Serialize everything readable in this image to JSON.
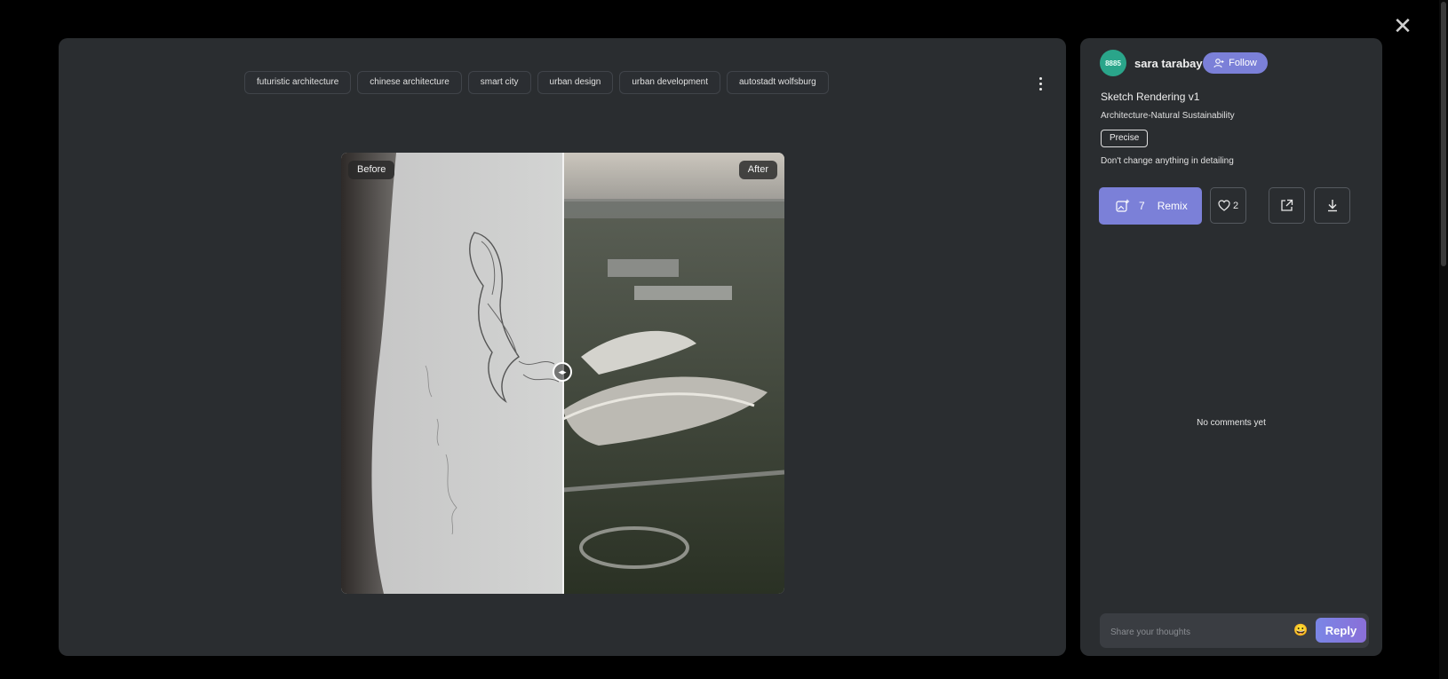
{
  "tags": [
    "futuristic architecture",
    "chinese architecture",
    "smart city",
    "urban design",
    "urban development",
    "autostadt wolfsburg"
  ],
  "compare": {
    "before_label": "Before",
    "after_label": "After",
    "split_fraction": 0.5
  },
  "icons": {
    "close": "close-icon",
    "more": "more-vertical-icon",
    "slider": "compare-slider-icon",
    "follow": "user-plus-icon",
    "remix": "image-plus-icon",
    "like": "heart-icon",
    "share": "external-link-icon",
    "download": "download-icon",
    "emoji": "emoji-icon"
  },
  "author": {
    "avatar_text": "8885",
    "name": "sara tarabay",
    "follow_label": "Follow",
    "avatar_color": "#2aa58a"
  },
  "model": {
    "name": "Sketch Rendering v1",
    "category": "Architecture-Natural Sustainability",
    "mode": "Precise",
    "prompt": "Don't change anything in detailing"
  },
  "actions": {
    "remix_count": "7",
    "remix_label": "Remix",
    "like_count": "2"
  },
  "comments": {
    "empty_text": "No comments yet",
    "placeholder": "Share your thoughts",
    "reply_label": "Reply"
  },
  "colors": {
    "accent": "#7b80d8",
    "panel": "#2a2d30",
    "background": "#000000"
  }
}
